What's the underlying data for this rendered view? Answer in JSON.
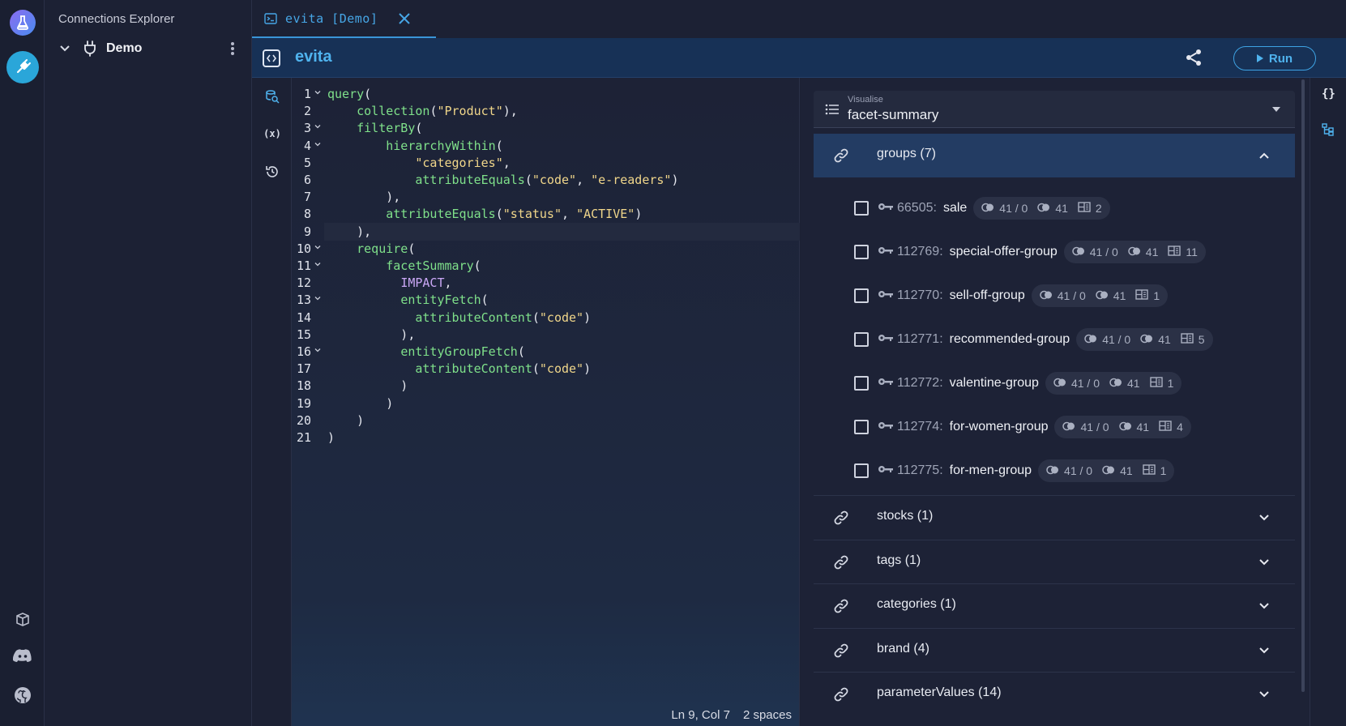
{
  "explorer": {
    "title": "Connections Explorer",
    "connection_name": "Demo"
  },
  "tab": {
    "label": "evita [Demo]"
  },
  "header": {
    "title": "evita",
    "run_label": "Run"
  },
  "editor": {
    "lines": [
      {
        "n": "1",
        "fold": true,
        "parts": [
          [
            "f",
            "query"
          ],
          [
            "p",
            "("
          ]
        ]
      },
      {
        "n": "2",
        "fold": false,
        "parts": [
          [
            "p",
            "    "
          ],
          [
            "f",
            "collection"
          ],
          [
            "p",
            "("
          ],
          [
            "s",
            "\"Product\""
          ],
          [
            "p",
            "),"
          ]
        ]
      },
      {
        "n": "3",
        "fold": true,
        "parts": [
          [
            "p",
            "    "
          ],
          [
            "f",
            "filterBy"
          ],
          [
            "p",
            "("
          ]
        ]
      },
      {
        "n": "4",
        "fold": true,
        "parts": [
          [
            "p",
            "        "
          ],
          [
            "f",
            "hierarchyWithin"
          ],
          [
            "p",
            "("
          ]
        ]
      },
      {
        "n": "5",
        "fold": false,
        "parts": [
          [
            "p",
            "            "
          ],
          [
            "s",
            "\"categories\""
          ],
          [
            "p",
            ","
          ]
        ]
      },
      {
        "n": "6",
        "fold": false,
        "parts": [
          [
            "p",
            "            "
          ],
          [
            "f",
            "attributeEquals"
          ],
          [
            "p",
            "("
          ],
          [
            "s",
            "\"code\""
          ],
          [
            "p",
            ", "
          ],
          [
            "s",
            "\"e-readers\""
          ],
          [
            "p",
            ")"
          ]
        ]
      },
      {
        "n": "7",
        "fold": false,
        "parts": [
          [
            "p",
            "        ),"
          ]
        ]
      },
      {
        "n": "8",
        "fold": false,
        "parts": [
          [
            "p",
            "        "
          ],
          [
            "f",
            "attributeEquals"
          ],
          [
            "p",
            "("
          ],
          [
            "s",
            "\"status\""
          ],
          [
            "p",
            ", "
          ],
          [
            "s",
            "\"ACTIVE\""
          ],
          [
            "p",
            ")"
          ]
        ]
      },
      {
        "n": "9",
        "fold": false,
        "parts": [
          [
            "p",
            "    ),"
          ]
        ]
      },
      {
        "n": "10",
        "fold": true,
        "parts": [
          [
            "p",
            "    "
          ],
          [
            "f",
            "require"
          ],
          [
            "p",
            "("
          ]
        ]
      },
      {
        "n": "11",
        "fold": true,
        "parts": [
          [
            "p",
            "        "
          ],
          [
            "f",
            "facetSummary"
          ],
          [
            "p",
            "("
          ]
        ]
      },
      {
        "n": "12",
        "fold": false,
        "parts": [
          [
            "p",
            "          "
          ],
          [
            "k",
            "IMPACT"
          ],
          [
            "p",
            ","
          ]
        ]
      },
      {
        "n": "13",
        "fold": true,
        "parts": [
          [
            "p",
            "          "
          ],
          [
            "f",
            "entityFetch"
          ],
          [
            "p",
            "("
          ]
        ]
      },
      {
        "n": "14",
        "fold": false,
        "parts": [
          [
            "p",
            "            "
          ],
          [
            "f",
            "attributeContent"
          ],
          [
            "p",
            "("
          ],
          [
            "s",
            "\"code\""
          ],
          [
            "p",
            ")"
          ]
        ]
      },
      {
        "n": "15",
        "fold": false,
        "parts": [
          [
            "p",
            "          ),"
          ]
        ]
      },
      {
        "n": "16",
        "fold": true,
        "parts": [
          [
            "p",
            "          "
          ],
          [
            "f",
            "entityGroupFetch"
          ],
          [
            "p",
            "("
          ]
        ]
      },
      {
        "n": "17",
        "fold": false,
        "parts": [
          [
            "p",
            "            "
          ],
          [
            "f",
            "attributeContent"
          ],
          [
            "p",
            "("
          ],
          [
            "s",
            "\"code\""
          ],
          [
            "p",
            ")"
          ]
        ]
      },
      {
        "n": "18",
        "fold": false,
        "parts": [
          [
            "p",
            "          )"
          ]
        ]
      },
      {
        "n": "19",
        "fold": false,
        "parts": [
          [
            "p",
            "        )"
          ]
        ]
      },
      {
        "n": "20",
        "fold": false,
        "parts": [
          [
            "p",
            "    )"
          ]
        ]
      },
      {
        "n": "21",
        "fold": false,
        "parts": [
          [
            "p",
            ")"
          ]
        ]
      }
    ],
    "current_line": "9",
    "status_position": "Ln 9, Col 7",
    "status_indent": "2 spaces"
  },
  "visualise": {
    "label": "Visualise",
    "value": "facet-summary"
  },
  "sections": {
    "groups": {
      "title": "groups (7)",
      "facets": [
        {
          "id": "66505:",
          "name": "sale",
          "requested": "41 / 0",
          "matched": "41",
          "count": "2"
        },
        {
          "id": "112769:",
          "name": "special-offer-group",
          "requested": "41 / 0",
          "matched": "41",
          "count": "11"
        },
        {
          "id": "112770:",
          "name": "sell-off-group",
          "requested": "41 / 0",
          "matched": "41",
          "count": "1"
        },
        {
          "id": "112771:",
          "name": "recommended-group",
          "requested": "41 / 0",
          "matched": "41",
          "count": "5"
        },
        {
          "id": "112772:",
          "name": "valentine-group",
          "requested": "41 / 0",
          "matched": "41",
          "count": "1"
        },
        {
          "id": "112774:",
          "name": "for-women-group",
          "requested": "41 / 0",
          "matched": "41",
          "count": "4"
        },
        {
          "id": "112775:",
          "name": "for-men-group",
          "requested": "41 / 0",
          "matched": "41",
          "count": "1"
        }
      ]
    },
    "collapsed": [
      {
        "title": "stocks (1)"
      },
      {
        "title": "tags (1)"
      },
      {
        "title": "categories (1)"
      },
      {
        "title": "brand (4)"
      },
      {
        "title": "parameterValues (14)"
      }
    ]
  },
  "icons": {
    "rail": [
      "lab-icon",
      "plug-icon",
      "book-icon",
      "discord-icon",
      "github-icon"
    ],
    "tools": [
      "schema-search-icon",
      "variables-icon",
      "history-icon"
    ],
    "right_rail": [
      "json-icon",
      "tree-icon"
    ]
  },
  "colors": {
    "accent": "#4fb3ee",
    "header_bg": "#173156",
    "open_section_bg": "#233c63",
    "function": "#7fe08a",
    "string": "#f0d68a",
    "constant": "#c9a7f5"
  }
}
